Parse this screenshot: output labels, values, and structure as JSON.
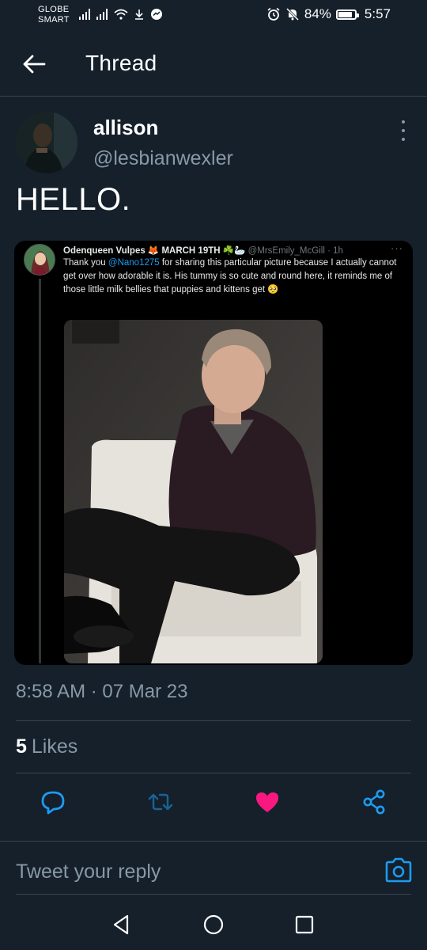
{
  "status_bar": {
    "carrier_line1": "GLOBE",
    "carrier_line2": "SMART",
    "battery": "84%",
    "battery_level": 0.84,
    "time": "5:57"
  },
  "header": {
    "title": "Thread"
  },
  "tweet": {
    "display_name": "allison",
    "handle": "@lesbianwexler",
    "text": "HELLO.",
    "timestamp": "8:58 AM · 07 Mar 23",
    "likes_count": "5",
    "likes_label": "Likes",
    "liked": true
  },
  "embedded_tweet": {
    "name": "Odenqueen Vulpes 🦊 MARCH 19TH ☘️🦢",
    "handle_time": "@MrsEmily_McGill · 1h",
    "body_pre": "Thank you ",
    "mention": "@Nano1275",
    "body_post": " for sharing this particular picture because I actually cannot get over how adorable it is. His tummy is so cute and round here, it reminds me of those little milk bellies that puppies and kittens get 🥺",
    "more": "···"
  },
  "reply": {
    "placeholder": "Tweet your reply"
  },
  "colors": {
    "background": "#15202b",
    "secondary_text": "#8899a6",
    "like_pink": "#f91880",
    "accent_blue": "#1d9bf0"
  }
}
